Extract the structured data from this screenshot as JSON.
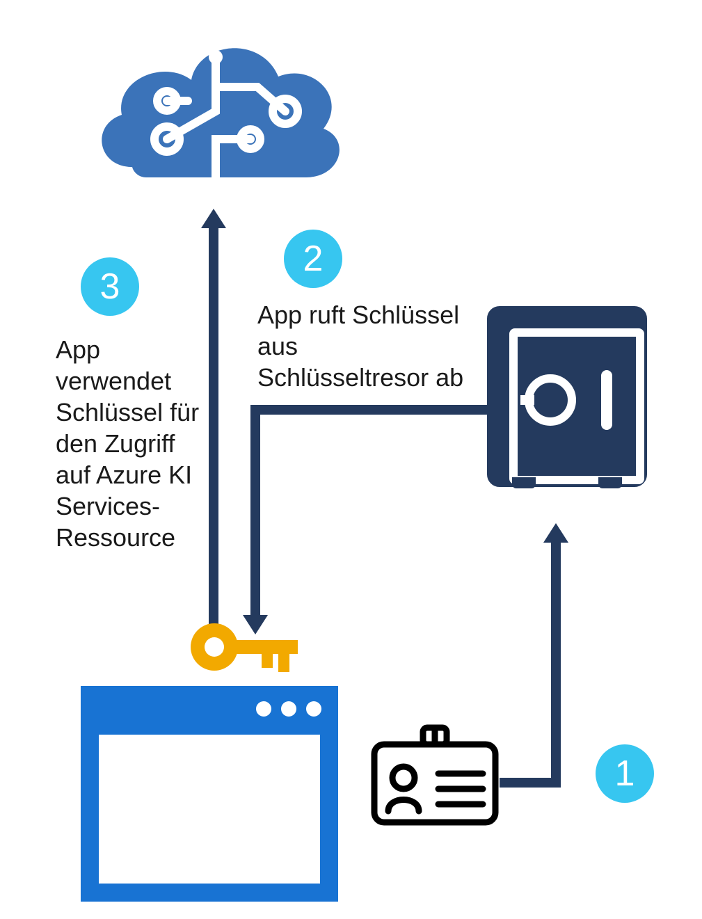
{
  "colors": {
    "badge": "#37c6f0",
    "cloud": "#3b73b9",
    "arrow": "#243a5e",
    "safe": "#243a5e",
    "appwin": "#1873d3",
    "key": "#f2a900",
    "idcard_stroke": "#000000"
  },
  "steps": {
    "s1": {
      "number": "1",
      "text": ""
    },
    "s2": {
      "number": "2",
      "text": "App ruft Schlüssel aus Schlüsseltresor ab"
    },
    "s3": {
      "number": "3",
      "text": "App verwendet Schlüssel für den Zugriff auf Azure KI Services-Ressource"
    }
  },
  "icons": {
    "cloud": "ai-cloud-brain-icon",
    "safe": "key-vault-safe-icon",
    "key": "key-icon",
    "app": "app-window-icon",
    "idcard": "identity-card-icon"
  }
}
